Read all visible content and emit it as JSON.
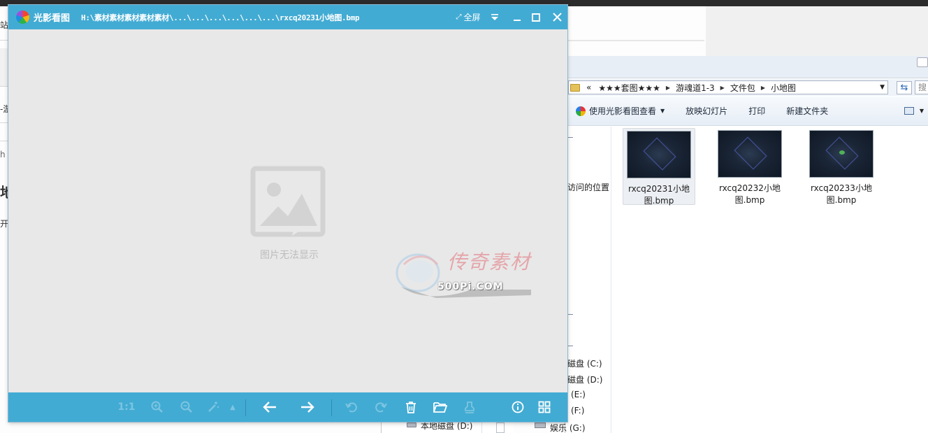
{
  "viewer": {
    "app_name": "光影看图",
    "path": "H:\\素材素材素材素材素材\\...\\...\\...\\...\\...\\...\\rxcq20231小地图.bmp",
    "fullscreen_label": "全屏",
    "placeholder_text": "图片无法显示",
    "watermark_title": "传奇素材",
    "watermark_url": "500Pi.COM",
    "toolbar": {
      "actual_size_label": "1:1"
    }
  },
  "explorer": {
    "breadcrumb": [
      "«",
      "★★★套图★★★",
      "游魂道1-3",
      "文件包",
      "小地图"
    ],
    "search_stub": "搜",
    "toolbar": [
      "使用光影看图查看",
      "放映幻灯片",
      "打印",
      "新建文件夹"
    ],
    "nav_items": [
      {
        "label": "访问的位置"
      },
      {
        "label": "磁盘 (C:)"
      },
      {
        "label": "磁盘 (D:)"
      },
      {
        "label": "(E:)"
      },
      {
        "label": "(F:)"
      }
    ],
    "files": [
      {
        "name_line1": "rxcq20231小地",
        "name_line2": "图.bmp",
        "selected": true
      },
      {
        "name_line1": "rxcq20232小地",
        "name_line2": "图.bmp",
        "selected": false
      },
      {
        "name_line1": "rxcq20233小地",
        "name_line2": "图.bmp",
        "selected": false
      }
    ]
  },
  "bottom_window": {
    "drive_label": "本地磁盘 (D:)",
    "drive_label_2": "娱乐 (G:)"
  },
  "bg_browser": {
    "seg1": "站务",
    "seg2": "-游",
    "seg3": "h",
    "seg4": "地",
    "seg5": "开。"
  },
  "colors": {
    "viewer_accent": "#42abd3",
    "canvas_bg": "#e8e8e8"
  }
}
